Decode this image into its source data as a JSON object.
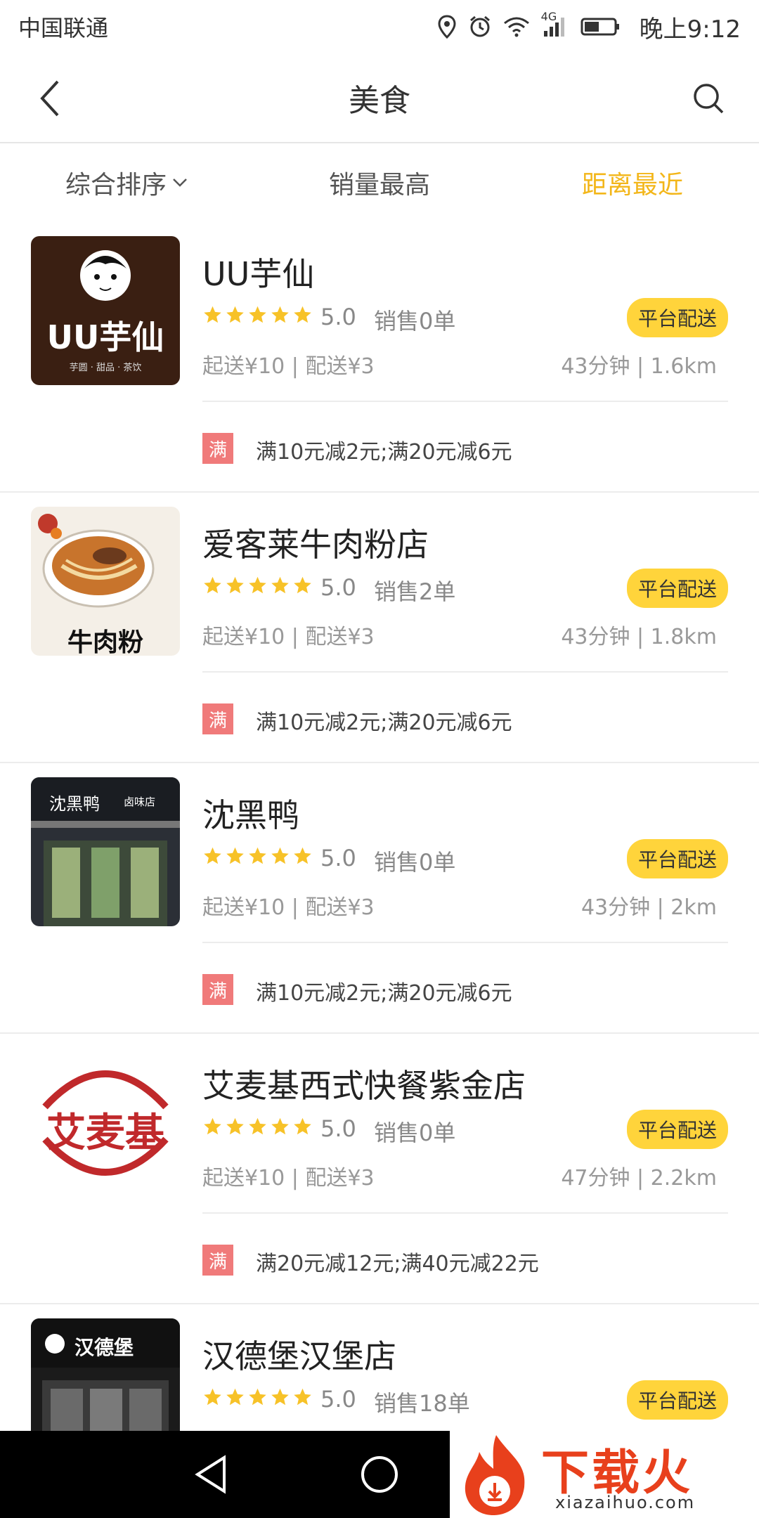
{
  "status_bar": {
    "carrier": "中国联通",
    "network": "4G",
    "time": "晚上9:12"
  },
  "header": {
    "title": "美食"
  },
  "filters": [
    {
      "label": "综合排序",
      "active": false,
      "has_dropdown": true
    },
    {
      "label": "销量最高",
      "active": false
    },
    {
      "label": "距离最近",
      "active": true
    }
  ],
  "colors": {
    "accent": "#f3b619",
    "badge": "#ffd43b",
    "promo": "#f07a7a",
    "star": "#f7c228"
  },
  "shops": [
    {
      "name": "UU芋仙",
      "rating": "5.0",
      "sales": "销售0单",
      "delivery": "平台配送",
      "fees": "起送¥10 | 配送¥3",
      "distance": "43分钟 | 1.6km",
      "promo_tag": "满",
      "promo": "满10元减2元;满20元减6元",
      "logo_text": "UU芋仙",
      "logo_subtext": "芋圆 · 甜品 · 茶饮"
    },
    {
      "name": "爱客莱牛肉粉店",
      "rating": "5.0",
      "sales": "销售2单",
      "delivery": "平台配送",
      "fees": "起送¥10 | 配送¥3",
      "distance": "43分钟 | 1.8km",
      "promo_tag": "满",
      "promo": "满10元减2元;满20元减6元",
      "logo_text": "牛肉粉"
    },
    {
      "name": "沈黑鸭",
      "rating": "5.0",
      "sales": "销售0单",
      "delivery": "平台配送",
      "fees": "起送¥10 | 配送¥3",
      "distance": "43分钟 | 2km",
      "promo_tag": "满",
      "promo": "满10元减2元;满20元减6元",
      "logo_text": "沈黑鸭",
      "logo_subtext": "卤味店"
    },
    {
      "name": "艾麦基西式快餐紫金店",
      "rating": "5.0",
      "sales": "销售0单",
      "delivery": "平台配送",
      "fees": "起送¥10 | 配送¥3",
      "distance": "47分钟 | 2.2km",
      "promo_tag": "满",
      "promo": "满20元减12元;满40元减22元",
      "logo_text": "艾麦基"
    },
    {
      "name": "汉德堡汉堡店",
      "rating": "5.0",
      "sales": "销售18单",
      "delivery": "平台配送",
      "logo_text": "汉德堡"
    }
  ],
  "watermark": {
    "text": "下载火",
    "url": "xiazaihuo.com"
  }
}
